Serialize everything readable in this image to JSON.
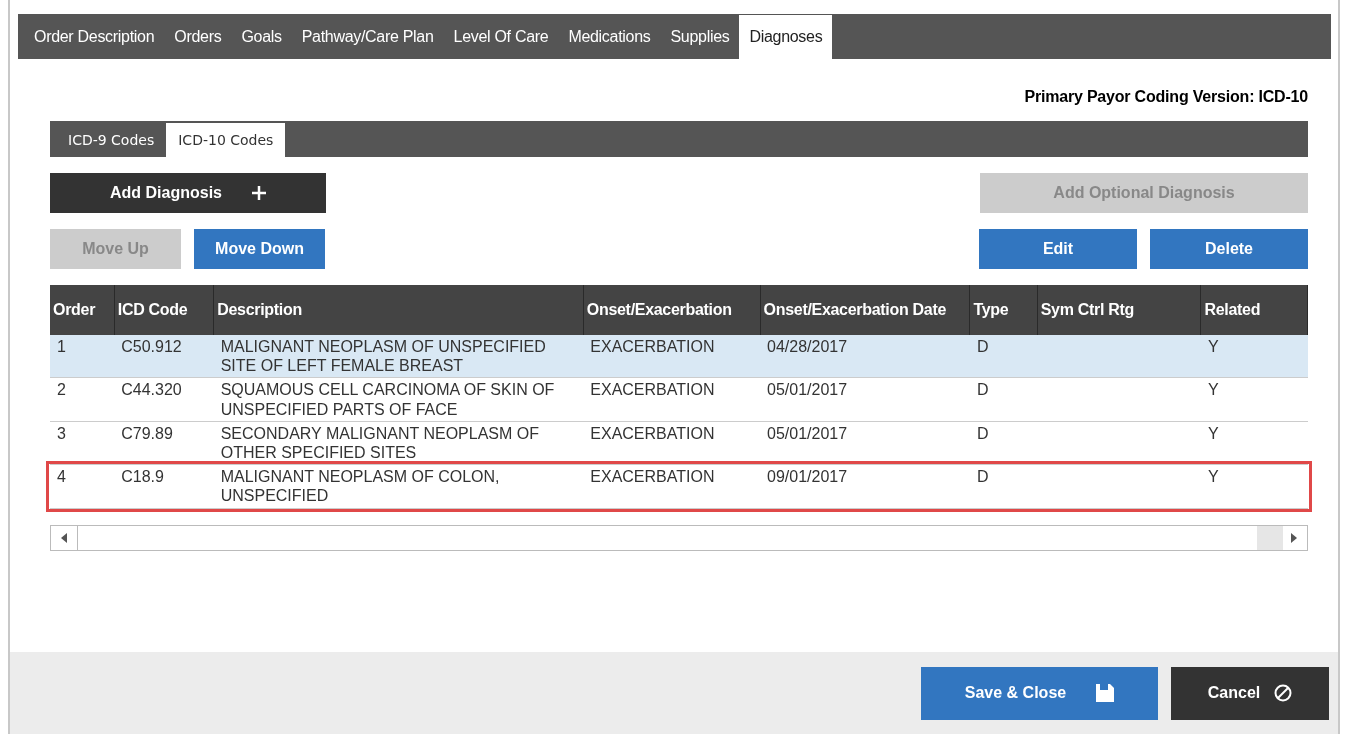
{
  "tabs": [
    {
      "label": "Order Description",
      "selected": false
    },
    {
      "label": "Orders",
      "selected": false
    },
    {
      "label": "Goals",
      "selected": false
    },
    {
      "label": "Pathway/Care Plan",
      "selected": false
    },
    {
      "label": "Level Of Care",
      "selected": false
    },
    {
      "label": "Medications",
      "selected": false
    },
    {
      "label": "Supplies",
      "selected": false
    },
    {
      "label": "Diagnoses",
      "selected": true
    }
  ],
  "coding_version": "Primary Payor Coding Version: ICD-10",
  "code_tabs": [
    {
      "label": "ICD-9 Codes",
      "selected": false
    },
    {
      "label": "ICD-10 Codes",
      "selected": true
    }
  ],
  "buttons": {
    "add_diagnosis": {
      "label": "Add Diagnosis",
      "disabled": false
    },
    "add_optional_diagnosis": {
      "label": "Add Optional Diagnosis",
      "disabled": true
    },
    "move_up": {
      "label": "Move Up",
      "disabled": true
    },
    "move_down": {
      "label": "Move Down",
      "disabled": false
    },
    "edit": {
      "label": "Edit",
      "disabled": false
    },
    "delete": {
      "label": "Delete",
      "disabled": false
    }
  },
  "table": {
    "columns": [
      "Order",
      "ICD Code",
      "Description",
      "Onset/Exacerbation",
      "Onset/Exacerbation Date",
      "Type",
      "Sym Ctrl Rtg",
      "Related"
    ],
    "rows": [
      {
        "cells": [
          "1",
          "C50.912",
          "MALIGNANT NEOPLASM OF UNSPECIFIED SITE OF LEFT FEMALE BREAST",
          "EXACERBATION",
          "04/28/2017",
          "D",
          "",
          "Y"
        ],
        "selected": true,
        "highlighted": false
      },
      {
        "cells": [
          "2",
          "C44.320",
          "SQUAMOUS CELL CARCINOMA OF SKIN OF UNSPECIFIED PARTS OF FACE",
          "EXACERBATION",
          "05/01/2017",
          "D",
          "",
          "Y"
        ],
        "selected": false,
        "highlighted": false
      },
      {
        "cells": [
          "3",
          "C79.89",
          "SECONDARY MALIGNANT NEOPLASM OF OTHER SPECIFIED SITES",
          "EXACERBATION",
          "05/01/2017",
          "D",
          "",
          "Y"
        ],
        "selected": false,
        "highlighted": false
      },
      {
        "cells": [
          "4",
          "C18.9",
          "MALIGNANT NEOPLASM OF COLON, UNSPECIFIED",
          "EXACERBATION",
          "09/01/2017",
          "D",
          "",
          "Y"
        ],
        "selected": false,
        "highlighted": true
      }
    ]
  },
  "footer": {
    "save": "Save & Close",
    "cancel": "Cancel"
  }
}
